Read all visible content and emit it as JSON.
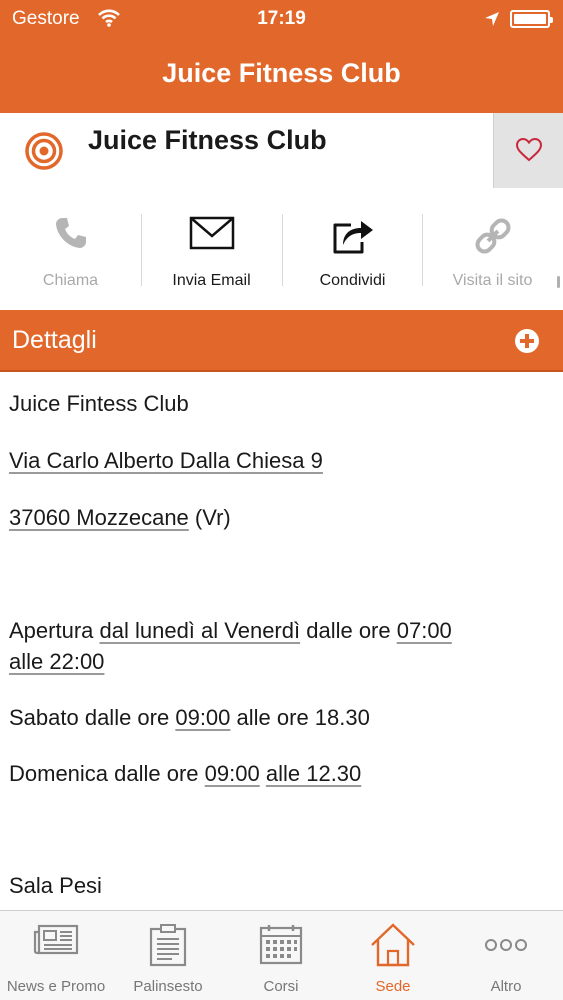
{
  "status_bar": {
    "carrier": "Gestore",
    "time": "17:19"
  },
  "nav": {
    "title": "Juice Fitness Club"
  },
  "header": {
    "club_name": "Juice Fitness Club"
  },
  "actions": [
    {
      "label": "Chiama",
      "icon": "phone-icon",
      "enabled": false
    },
    {
      "label": "Invia Email",
      "icon": "envelope-icon",
      "enabled": true
    },
    {
      "label": "Condividi",
      "icon": "share-icon",
      "enabled": true
    },
    {
      "label": "Visita il sito",
      "icon": "link-icon",
      "enabled": false
    }
  ],
  "details": {
    "title": "Dettagli",
    "name": "Juice Fintess Club",
    "address": "Via Carlo Alberto Dalla Chiesa 9",
    "zip": "37060 Mozzecane",
    "province": " (Vr)",
    "weekday": {
      "prefix": "Apertura ",
      "days": "dal lunedì al Venerdì",
      "middle": " dalle ore ",
      "open": "07:00",
      "close": "alle 22:00"
    },
    "saturday": {
      "prefix": "Sabato dalle ore ",
      "open": "09:00",
      "rest": " alle ore 18.30"
    },
    "sunday": {
      "prefix": "Domenica dalle ore ",
      "open": "09:00",
      "close": "alle 12.30"
    },
    "section": "Sala Pesi"
  },
  "tabs": [
    {
      "label": "News e Promo",
      "icon": "newspaper-icon",
      "active": false
    },
    {
      "label": "Palinsesto",
      "icon": "clipboard-icon",
      "active": false
    },
    {
      "label": "Corsi",
      "icon": "calendar-icon",
      "active": false
    },
    {
      "label": "Sede",
      "icon": "home-icon",
      "active": true
    },
    {
      "label": "Altro",
      "icon": "more-icon",
      "active": false
    }
  ],
  "colors": {
    "accent": "#e2672a",
    "heart": "#c8283c",
    "inactive": "#a9a9a9"
  }
}
